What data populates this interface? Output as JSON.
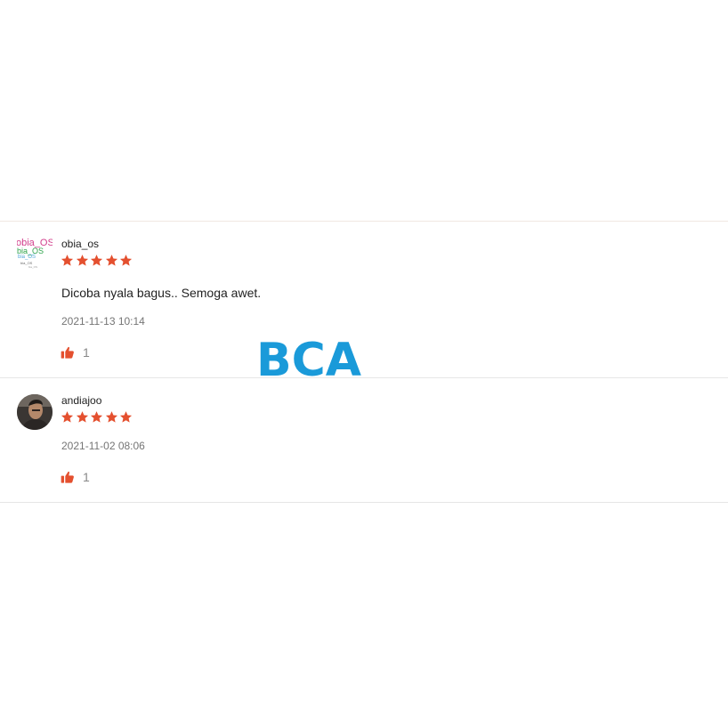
{
  "colors": {
    "star": "#e4502f",
    "thumb": "#e4502f",
    "watermark": "#1a9ad9",
    "timestamp": "#757575",
    "divider": "#e6e6e6"
  },
  "reviews": [
    {
      "username": "obia_os",
      "avatar": {
        "type": "text-logo",
        "lines": [
          "obia_OS",
          "bia_OS",
          "bia_OS",
          "bia_OS",
          "bia_OS"
        ]
      },
      "rating": 5,
      "comment": "Dicoba nyala bagus.. Semoga awet.",
      "timestamp": "2021-11-13 10:14",
      "likes": "1",
      "like_icon": "thumbs-up-icon"
    },
    {
      "username": "andiajoo",
      "avatar": {
        "type": "photo"
      },
      "rating": 5,
      "comment": "",
      "timestamp": "2021-11-02 08:06",
      "likes": "1",
      "like_icon": "thumbs-up-icon"
    }
  ],
  "watermark_text": "BCA"
}
